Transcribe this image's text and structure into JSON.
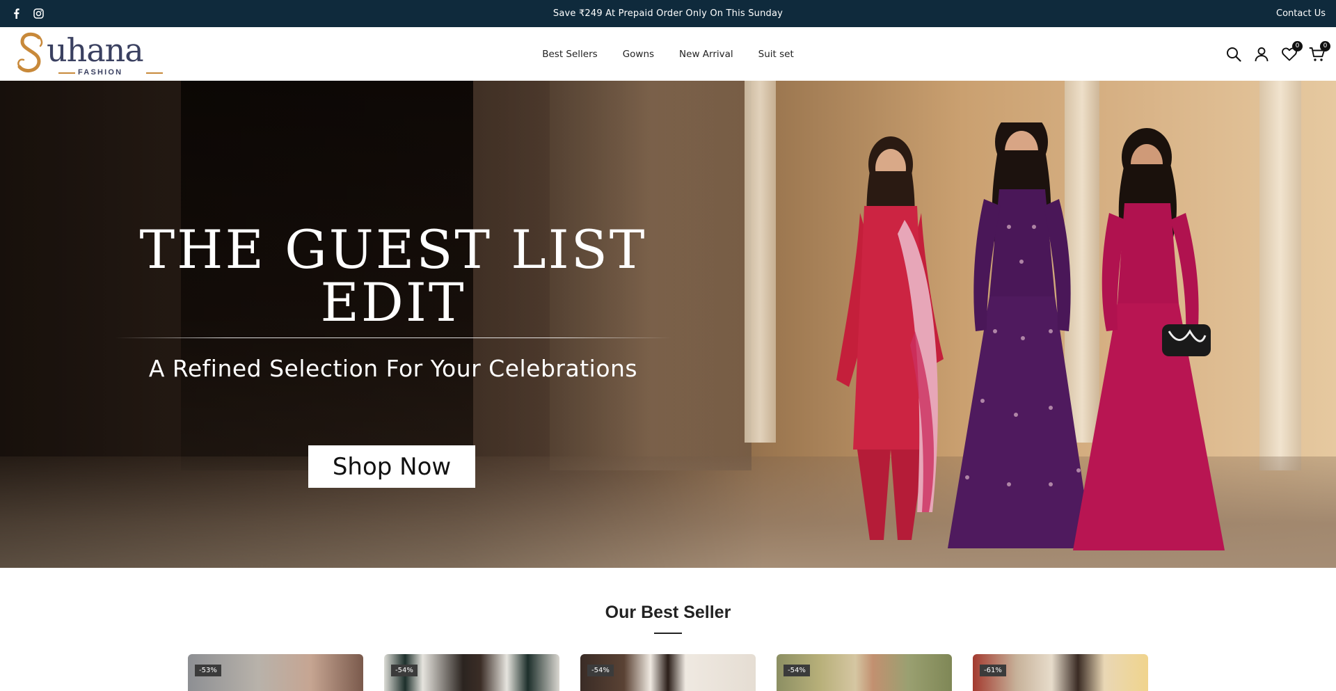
{
  "announcement": {
    "message": "Save ₹249 At Prepaid Order Only On This Sunday",
    "contact_label": "Contact Us",
    "social_icons": [
      "facebook-icon",
      "instagram-icon"
    ]
  },
  "header": {
    "logo_word": "uhana",
    "logo_sub": "FASHION",
    "nav": [
      "Best Sellers",
      "Gowns",
      "New Arrival",
      "Suit set"
    ],
    "wishlist_count": "0",
    "cart_count": "0",
    "icons": [
      "search-icon",
      "user-icon",
      "heart-icon",
      "cart-icon"
    ]
  },
  "hero": {
    "title": "THE GUEST LIST EDIT",
    "subtitle": "A Refined Selection For Your Celebrations",
    "button_label": "Shop Now"
  },
  "best_seller": {
    "title": "Our Best Seller",
    "products": [
      {
        "discount": "-53%"
      },
      {
        "discount": "-54%"
      },
      {
        "discount": "-54%"
      },
      {
        "discount": "-54%"
      },
      {
        "discount": "-61%"
      }
    ]
  },
  "colors": {
    "announcement_bg": "#0f2a3c",
    "brand_text": "#3a4060",
    "brand_accent": "#c8893a"
  }
}
